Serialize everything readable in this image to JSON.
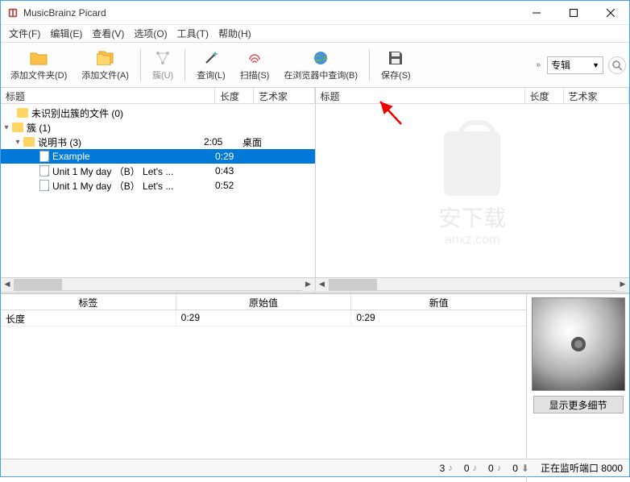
{
  "app": {
    "title": "MusicBrainz Picard"
  },
  "menu": {
    "file": "文件(F)",
    "edit": "编辑(E)",
    "view": "查看(V)",
    "options": "选项(O)",
    "tools": "工具(T)",
    "help": "帮助(H)"
  },
  "toolbar": {
    "add_folder": "添加文件夹(D)",
    "add_files": "添加文件(A)",
    "cluster": "簇(U)",
    "lookup": "查询(L)",
    "scan": "扫描(S)",
    "browser_lookup": "在浏览器中查询(B)",
    "save": "保存(S)",
    "select_value": "专辑"
  },
  "cols": {
    "title": "标题",
    "length": "长度",
    "artist": "艺术家"
  },
  "left_tree": {
    "unclustered": "未识别出簇的文件 (0)",
    "clusters": "簇 (1)",
    "cluster_name": "说明书 (3)",
    "album_label": "桌面",
    "rows": [
      {
        "title": "Example",
        "length": "0:29",
        "selected": true
      },
      {
        "title": "Unit 1 My day （B） Let's ...",
        "length": "0:43",
        "selected": false
      },
      {
        "title": "Unit 1 My day （B） Let's ...",
        "length": "0:52",
        "selected": false
      }
    ],
    "cluster_length": "2:05"
  },
  "props": {
    "col_tag": "标签",
    "col_orig": "原始值",
    "col_new": "新值",
    "row1": {
      "tag": "长度",
      "orig": "0:29",
      "new": "0:29"
    }
  },
  "cover": {
    "detail_btn": "显示更多细节"
  },
  "status": {
    "count1": "3",
    "count2": "0",
    "count3": "0",
    "count4": "0",
    "listening": "正在监听端口 8000"
  },
  "watermark": {
    "txt": "安下载",
    "url": "anxz.com"
  }
}
